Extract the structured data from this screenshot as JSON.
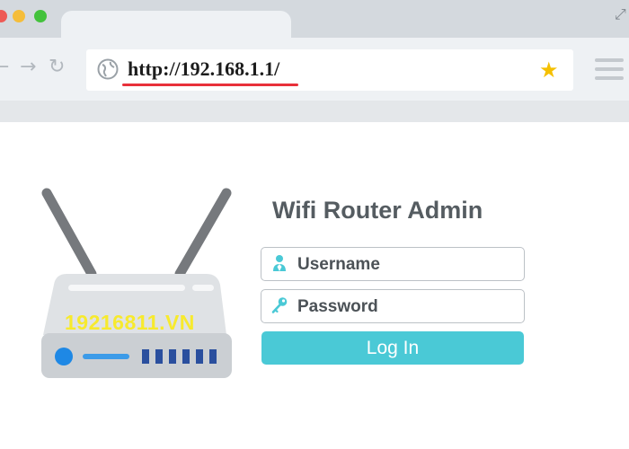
{
  "browser": {
    "address_url": "http://192.168.1.1/",
    "icons": [
      "back-arrow-icon",
      "forward-arrow-icon",
      "reload-icon",
      "globe-icon",
      "bookmark-star-icon",
      "menu-icon",
      "expand-icon"
    ],
    "colors": {
      "accent": "#4ac9d6",
      "underline": "#e8303a",
      "star": "#f5c000"
    }
  },
  "router_image": {
    "watermark": "19216811.VN"
  },
  "login": {
    "title": "Wifi Router Admin",
    "username_placeholder": "Username",
    "password_placeholder": "Password",
    "button_label": "Log In"
  }
}
